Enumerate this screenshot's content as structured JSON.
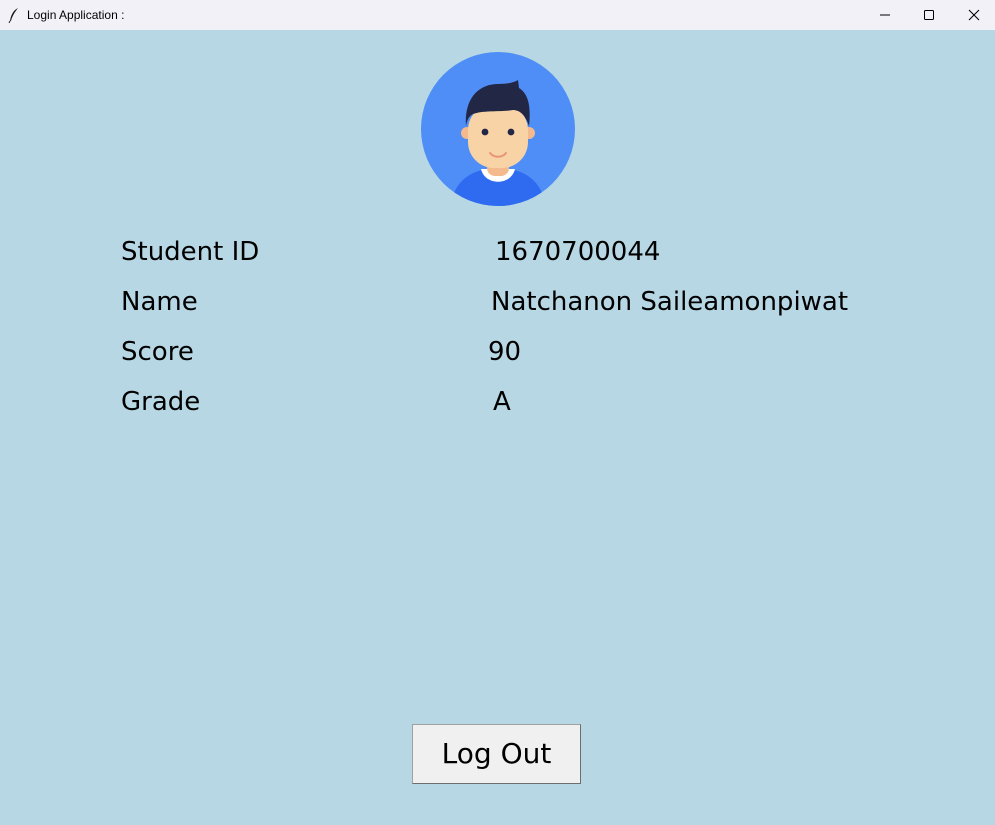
{
  "window": {
    "title": "Login Application :"
  },
  "student": {
    "rows": [
      {
        "label": "Student ID",
        "value": "1670700044"
      },
      {
        "label": "Name",
        "value": "Natchanon Saileamonpiwat"
      },
      {
        "label": "Score",
        "value": "90"
      },
      {
        "label": "Grade",
        "value": "A"
      }
    ]
  },
  "actions": {
    "logout_label": "Log Out"
  },
  "colors": {
    "background": "#b7d7e4",
    "avatar_circle": "#4f8ef7",
    "titlebar": "#f3f1f8"
  }
}
